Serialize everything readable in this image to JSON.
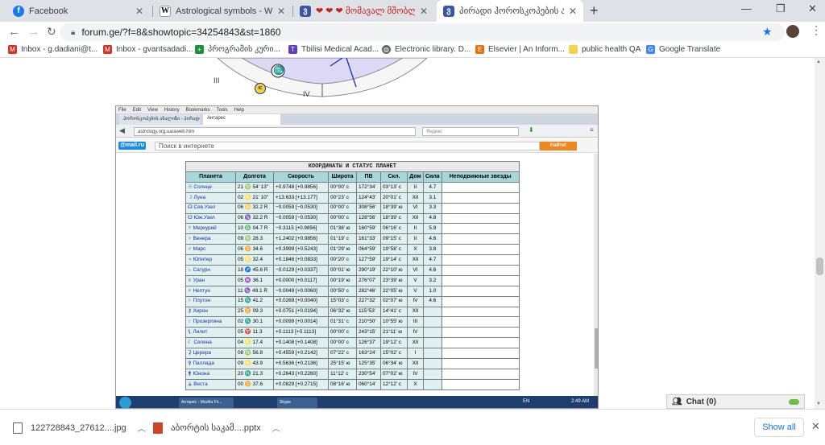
{
  "tabs": [
    {
      "title": "Facebook",
      "favicon_color": "#1877f2",
      "favicon_glyph": "f",
      "active": false
    },
    {
      "title": "Astrological symbols - Wikipedia",
      "favicon_color": "#ffffff",
      "favicon_glyph": "W",
      "active": false
    },
    {
      "title": "❤ ❤ ❤ მომავალ მშობლები",
      "favicon_color": "#3a56a5",
      "favicon_glyph": "ვ",
      "active": false
    },
    {
      "title": "პირადი ჰოროსკოპების ანალიზი",
      "favicon_color": "#3a56a5",
      "favicon_glyph": "ვ",
      "active": true
    }
  ],
  "window": {
    "new_tab": "+",
    "minimize": "—",
    "restore": "❐",
    "close": "✕"
  },
  "omnibox": {
    "url": "forum.ge/?f=8&showtopic=34254843&st=1860",
    "star_icon": "star-icon",
    "lock_icon": "lock-icon"
  },
  "bookmarks": [
    {
      "label": "Inbox - g.dadiani@t...",
      "icon": "gmail-icon",
      "color": "#d93025"
    },
    {
      "label": "Inbox - gvantsadadi...",
      "icon": "gmail-icon",
      "color": "#d93025"
    },
    {
      "label": "პროგრამის კური...",
      "icon": "plus-icon",
      "color": "#1e8e3e"
    },
    {
      "label": "Tbilisi Medical Acad...",
      "icon": "tma-icon",
      "color": "#5f3dc4"
    },
    {
      "label": "Electronic library. D...",
      "icon": "globe-icon",
      "color": "#5f6368"
    },
    {
      "label": "Elsevier | An Inform...",
      "icon": "elsevier-icon",
      "color": "#e8710a"
    },
    {
      "label": "public health QA",
      "icon": "folder-icon",
      "color": "#f9d24d"
    },
    {
      "label": "Google Translate",
      "icon": "translate-icon",
      "color": "#4285f4"
    }
  ],
  "chart": {
    "house_3": "III",
    "house_4": "IV",
    "sign_glyph": "♏",
    "ic_label": "IC"
  },
  "shot": {
    "menu": [
      "File",
      "Edit",
      "View",
      "History",
      "Bookmarks",
      "Tools",
      "Help"
    ],
    "tabs": [
      "ჰოროსკოპების ანალიზი - პირადი...",
      "Антарес"
    ],
    "url": "astrology.org.ua/aweb.htm",
    "search_placeholder": "Яндекс",
    "mailru_logo": "@mail.ru",
    "mail_search_placeholder": "Поиск в интернете",
    "mail_search_button": "Найти!",
    "table_title": "КООРДИНАТЫ И СТАТУС ПЛАНЕТ",
    "columns": [
      "Планета",
      "Долгота",
      "Скорость",
      "Широта",
      "ПВ",
      "Скл.",
      "Дом",
      "Сила",
      "Неподвижные звезды"
    ],
    "rows": [
      [
        "☉ Солнце",
        "21 ♍ 54' 13\"",
        "+0.9748 [+0.9856]",
        "00°00' с",
        "172°34'",
        "03°13' с",
        "II",
        "4.7"
      ],
      [
        "☽ Луна",
        "02 ♌ 21' 10\"",
        "+13.633 [+13.177]",
        "00°23' с",
        "124°43'",
        "20°01' с",
        "XII",
        "3.1"
      ],
      [
        "☊ Сев.Узел",
        "06 ♋ 32.2 R",
        "−0.0059 [−0.0530]",
        "00°00' с",
        "308°56'",
        "18°39' ю",
        "VI",
        "3.3"
      ],
      [
        "☋ Юж.Узел",
        "06 ♑ 32.2 R",
        "−0.0059 [−0.0530]",
        "00°00' с",
        "128°56'",
        "18°39' с",
        "XII",
        "4.8"
      ],
      [
        "☿ Меркурий",
        "10 ♎ 04.7 R",
        "−0.3115 [+0.9856]",
        "01°38' ю",
        "160°59'",
        "06°16' с",
        "II",
        "5.9"
      ],
      [
        "♀ Венера",
        "09 ♍ 28.3",
        "+1.2402 [+0.9856]",
        "01°19' с",
        "161°33'",
        "09°15' с",
        "II",
        "4.6"
      ],
      [
        "♂ Марс",
        "06 ♊ 34.6",
        "+0.3999 [+0.5243]",
        "01°29' ю",
        "064°59'",
        "19°58' с",
        "X",
        "3.8"
      ],
      [
        "♃ Юпитер",
        "05 ♌ 32.4",
        "+0.1846 [+0.0833]",
        "00°20' с",
        "127°59'",
        "19°14' с",
        "XII",
        "4.7"
      ],
      [
        "♄ Сатурн",
        "18 ♐ 45.6 R",
        "−0.0129 [+0.0337]",
        "00°01' ю",
        "290°19'",
        "22°10' ю",
        "VI",
        "4.6"
      ],
      [
        "♅ Уран",
        "05 ♒ 36.1",
        "+0.0000 [+0.0117]",
        "00°19' ю",
        "276°07'",
        "23°39' ю",
        "V",
        "3.2"
      ],
      [
        "♆ Нептун",
        "11 ♑ 49.1 R",
        "−0.0049 [+0.0060]",
        "00°50' с",
        "282°46'",
        "22°05' ю",
        "V",
        "1.0"
      ],
      [
        "♇ Плутон",
        "15 ♏ 41.2",
        "+0.0269 [+0.0040]",
        "15°03' с",
        "227°32'",
        "02°07' ю",
        "IV",
        "4.6"
      ],
      [
        "⚷ Хирон",
        "25 ♊ 09.3",
        "+0.0751 [+0.0194]",
        "06°32' ю",
        "115°53'",
        "14°41' с",
        "XII",
        ""
      ],
      [
        "♇ Прозерпина",
        "02 ♏ 30.1",
        "+0.0099 [+0.0014]",
        "01°31' с",
        "210°50'",
        "10°55' ю",
        "III",
        ""
      ],
      [
        "⚸ Лилит",
        "05 ♈ 11.3",
        "+0.1113 [+0.1113]",
        "00°00' с",
        "243°15'",
        "21°11' ю",
        "IV",
        ""
      ],
      [
        "☾ Селена",
        "04 ♌ 17.4",
        "+0.1408 [+0.1408]",
        "00°00' с",
        "126°37'",
        "19°12' с",
        "XII",
        ""
      ],
      [
        "⚳ Церера",
        "08 ♍ 56.8",
        "+0.4559 [+0.2142]",
        "07°22' с",
        "163°24'",
        "15°02' с",
        "I",
        ""
      ],
      [
        "⚴ Паллада",
        "09 ♌ 43.9",
        "+0.5636 [+0.2136]",
        "25°15' ю",
        "125°35'",
        "06°34' ю",
        "XII",
        ""
      ],
      [
        "⚵ Юнона",
        "20 ♏ 21.3",
        "+0.2643 [+0.2260]",
        "11°12' с",
        "230°54'",
        "07°02' ю",
        "IV",
        ""
      ],
      [
        "⚶ Веста",
        "00 ♊ 37.6",
        "+0.0829 [+0.2715]",
        "08°16' ю",
        "060°14'",
        "12°12' с",
        "X",
        ""
      ]
    ],
    "taskbar_items": [
      "Антарес - Mozilla Fir...",
      "Skype"
    ],
    "tray_lang": "EN",
    "tray_time": "2:49 AM"
  },
  "chat": {
    "label": "Chat (0)"
  },
  "downloads": [
    {
      "name": "122728843_27612....jpg",
      "icon": "image-file-icon"
    },
    {
      "name": "აბორტის საკამ....pptx",
      "icon": "pptx-file-icon"
    }
  ],
  "show_all": "Show all",
  "colors": {
    "accent": "#1a73e8",
    "table_header": "#a6d7db",
    "table_cell": "#dff0f0"
  }
}
